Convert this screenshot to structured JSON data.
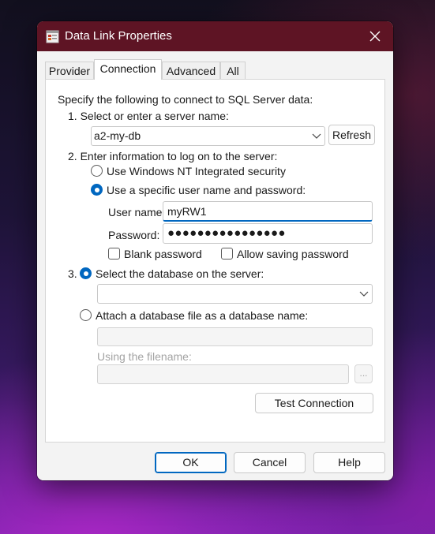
{
  "window": {
    "title": "Data Link Properties",
    "titlebar_color": "#5e1424",
    "accent_color": "#0067c0"
  },
  "tabs": [
    {
      "label": "Provider"
    },
    {
      "label": "Connection"
    },
    {
      "label": "Advanced"
    },
    {
      "label": "All"
    }
  ],
  "connection": {
    "intro": "Specify the following to connect to SQL Server data:",
    "step1_label": "1. Select or enter a server name:",
    "server_name": "a2-my-db",
    "refresh_label": "Refresh",
    "step2_label": "2. Enter information to log on to the server:",
    "radio_nt_label": "Use Windows NT Integrated security",
    "radio_specific_label": "Use a specific user name and password:",
    "username_label": "User name:",
    "username_value": "myRW1",
    "password_label": "Password:",
    "password_value": "●●●●●●●●●●●●●●●●",
    "blank_password_label": "Blank password",
    "allow_saving_label": "Allow saving password",
    "step3_number": "3.",
    "radio_select_db_label": "Select the database on the server:",
    "database_value": "",
    "radio_attach_label": "Attach a database file as a database name:",
    "attach_name_value": "",
    "using_filename_label": "Using the filename:",
    "filename_value": "",
    "browse_label": "...",
    "test_connection_label": "Test Connection"
  },
  "footer": {
    "ok_label": "OK",
    "cancel_label": "Cancel",
    "help_label": "Help"
  }
}
